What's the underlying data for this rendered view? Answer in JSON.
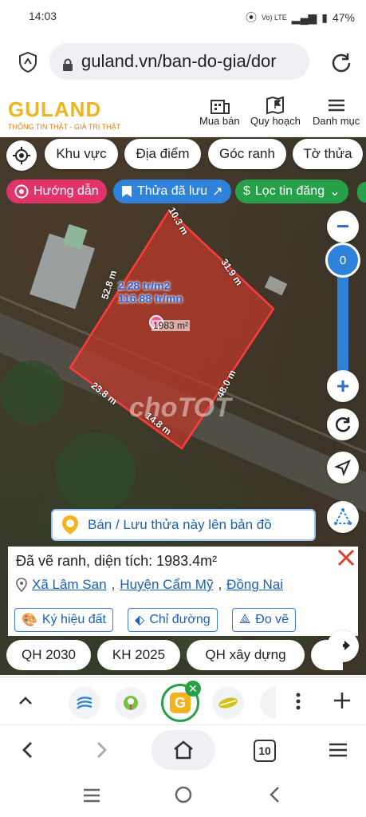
{
  "status": {
    "time": "14:03",
    "network": "Vo) LTE",
    "battery": "47%"
  },
  "browser": {
    "url": "guland.vn/ban-do-gia/dor",
    "tab_count": "10"
  },
  "header": {
    "logo_text": "GULAND",
    "tagline": "THÔNG TIN THẬT - GIÁ TRỊ THẬT",
    "nav": [
      {
        "label": "Mua bán"
      },
      {
        "label": "Quy hoạch"
      },
      {
        "label": "Danh mục"
      }
    ]
  },
  "map_filters": {
    "chips": [
      "Khu vực",
      "Địa điểm",
      "Góc ranh",
      "Tờ thửa"
    ]
  },
  "action_pills": [
    {
      "label": "Hướng dẫn",
      "color": "#e2336b"
    },
    {
      "label": "Thửa đã lưu",
      "color": "#2e82d9"
    },
    {
      "label": "Lọc tin đăng",
      "color": "#27a04a"
    }
  ],
  "zoom": {
    "level": "0",
    "minus": "−",
    "plus": "+"
  },
  "parcel": {
    "price_per_m2": "2.28 tr/m2",
    "total_price": "116.88 tr/mn",
    "area_label": "1983 m²",
    "edges": [
      "10.3 m",
      "31.9 m",
      "52.8 m",
      "48.0 m",
      "23.8 m",
      "14.8 m"
    ]
  },
  "watermark": "choTOT",
  "save_banner": {
    "label": "Bán / Lưu thửa này lên bản đồ"
  },
  "info_card": {
    "title": "Đã vẽ ranh, diện tích: 1983.4m²",
    "location": {
      "commune": "Xã Lâm San",
      "district": "Huyện Cẩm Mỹ",
      "province": "Đồng Nai"
    },
    "actions": [
      "Ký hiệu đất",
      "Chỉ đường",
      "Đo vẽ"
    ]
  },
  "bottom_chips": [
    "QH 2030",
    "KH 2025",
    "QH xây dựng"
  ],
  "colors": {
    "accent": "#2e82d9",
    "parcel_fill": "#c0392b",
    "brand": "#f2b41e"
  }
}
